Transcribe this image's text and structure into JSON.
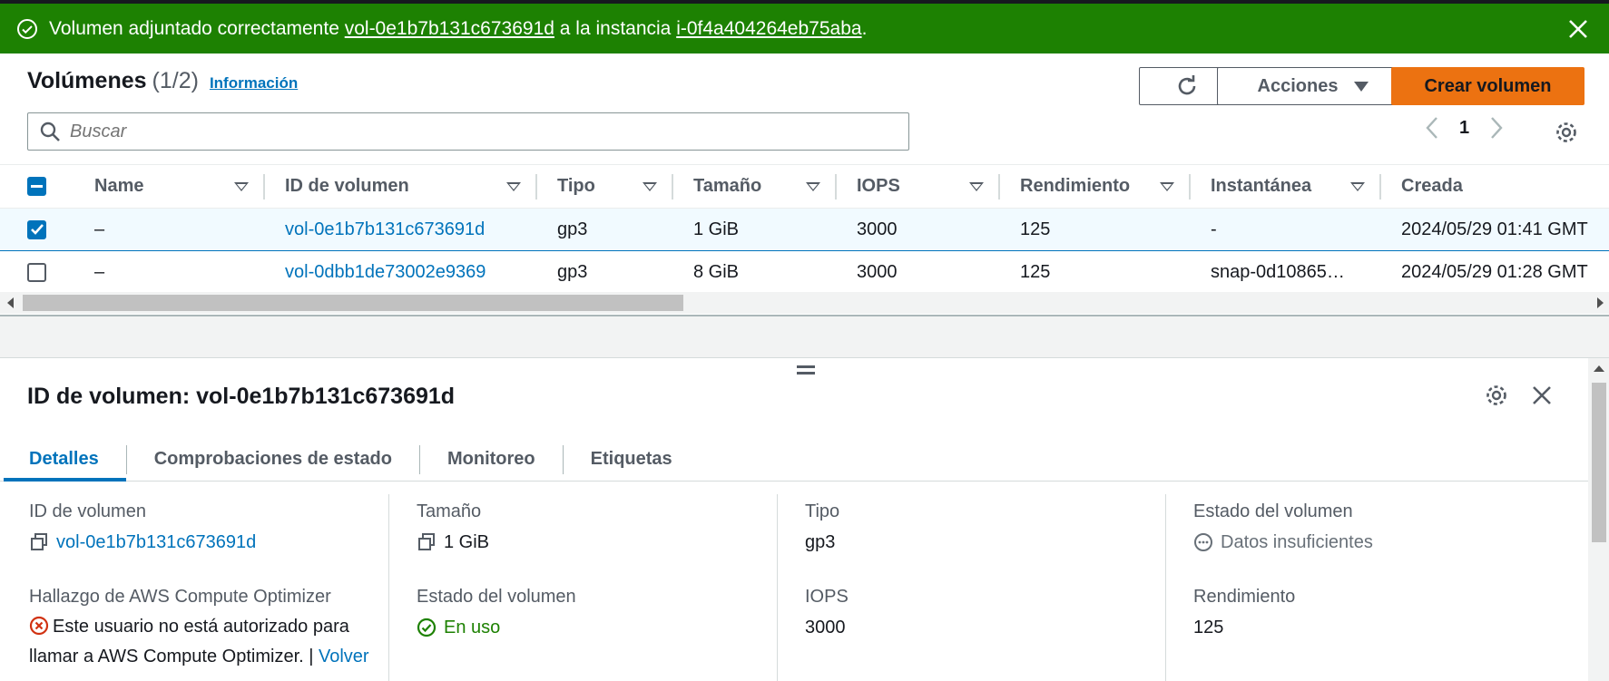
{
  "flash": {
    "prefix": "Volumen adjuntado correctamente",
    "volume_link": "vol-0e1b7b131c673691d",
    "middle": "a la instancia",
    "instance_link": "i-0f4a404264eb75aba",
    "suffix": ".",
    "color": "#1d8102"
  },
  "header": {
    "title": "Volúmenes",
    "count": "(1/2)",
    "info": "Información",
    "actions_label": "Acciones",
    "create_label": "Crear volumen",
    "search_placeholder": "Buscar",
    "page": "1"
  },
  "table": {
    "columns": [
      "Name",
      "ID de volumen",
      "Tipo",
      "Tamaño",
      "IOPS",
      "Rendimiento",
      "Instantánea",
      "Creada"
    ],
    "rows": [
      {
        "selected": true,
        "name": "–",
        "id": "vol-0e1b7b131c673691d",
        "type": "gp3",
        "size": "1 GiB",
        "iops": "3000",
        "throughput": "125",
        "snapshot": "-",
        "created": "2024/05/29 01:41 GMT"
      },
      {
        "selected": false,
        "name": "–",
        "id": "vol-0dbb1de73002e9369",
        "type": "gp3",
        "size": "8 GiB",
        "iops": "3000",
        "throughput": "125",
        "snapshot": "snap-0d10865…",
        "created": "2024/05/29 01:28 GMT"
      }
    ]
  },
  "detail": {
    "title": "ID de volumen: vol-0e1b7b131c673691d",
    "tabs": [
      "Detalles",
      "Comprobaciones de estado",
      "Monitoreo",
      "Etiquetas"
    ],
    "fields": {
      "volume_id_label": "ID de volumen",
      "volume_id_value": "vol-0e1b7b131c673691d",
      "size_label": "Tamaño",
      "size_value": "1 GiB",
      "type_label": "Tipo",
      "type_value": "gp3",
      "vol_status_label": "Estado del volumen",
      "vol_status_value": "Datos insuficientes",
      "optimizer_label": "Hallazgo de AWS Compute Optimizer",
      "optimizer_error": "Este usuario no está autorizado para llamar a AWS Compute Optimizer.",
      "optimizer_sep": " | ",
      "optimizer_retry": "Volver",
      "vol_state_label": "Estado del volumen",
      "vol_state_value": "En uso",
      "iops_label": "IOPS",
      "iops_value": "3000",
      "throughput_label": "Rendimiento",
      "throughput_value": "125"
    }
  },
  "colors": {
    "accent": "#0073bb",
    "primary_button": "#ec7211",
    "success": "#1d8102",
    "error": "#d13212"
  }
}
